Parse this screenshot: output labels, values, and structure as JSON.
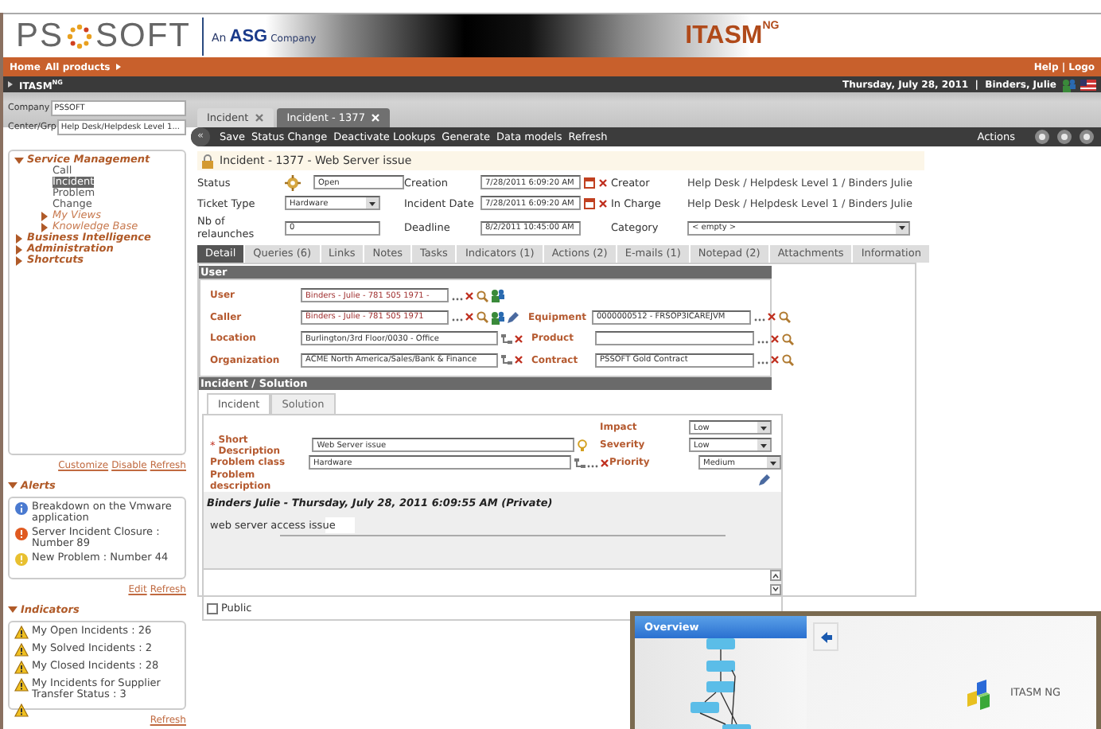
{
  "header": {
    "logo_left": "PS",
    "logo_right": "SOFT",
    "tagline_prefix": "An",
    "tagline_brand": "ASG",
    "tagline_suffix": "Company",
    "app_title": "ITASM",
    "app_title_sup": "NG"
  },
  "nav_bar": {
    "links": [
      "Home",
      "All products"
    ],
    "right_text": "Help | Logo"
  },
  "sub_bar": {
    "crumb": "ITASM$^{NG}$",
    "date_user": "Thursday, July 28, 2011  |  Binders, Julie"
  },
  "sidebar": {
    "company_label": "Company",
    "company_value": "PSSOFT",
    "center_label": "Center/Grp",
    "center_value": "Help Desk/Helpdesk Level 1...",
    "tree": [
      {
        "label": "Service Management",
        "expanded": true,
        "children": [
          {
            "label": "Call",
            "selected": false
          },
          {
            "label": "Incident",
            "selected": true
          },
          {
            "label": "Problem",
            "selected": false
          },
          {
            "label": "Change",
            "selected": false
          },
          {
            "label": "My Views",
            "expanded": false
          },
          {
            "label": "Knowledge Base",
            "expanded": false
          }
        ]
      },
      {
        "label": "Business Intelligence",
        "expanded": false
      },
      {
        "label": "Administration",
        "expanded": false
      },
      {
        "label": "Shortcuts",
        "expanded": false
      }
    ],
    "tree_links": [
      "Customize",
      "Disable",
      "Refresh"
    ],
    "alerts": {
      "title": "Alerts",
      "items": [
        {
          "kind": "info",
          "text": "Breakdown on the Vmware application"
        },
        {
          "kind": "error",
          "text": "Server Incident Closure : Number 89"
        },
        {
          "kind": "notice",
          "text": "New Problem : Number 44"
        }
      ],
      "links": [
        "Edit",
        "Refresh"
      ]
    },
    "indicators": {
      "title": "Indicators",
      "items": [
        {
          "kind": "warning",
          "text": "My Open Incidents : 26"
        },
        {
          "kind": "warning",
          "text": "My Solved Incidents : 2"
        },
        {
          "kind": "warning",
          "text": "My Closed Incidents : 28"
        },
        {
          "kind": "warning",
          "text": "My Incidents for Supplier Transfer Status : 3"
        },
        {
          "kind": "warning"
        }
      ],
      "links": [
        "Refresh"
      ]
    }
  },
  "tabs": [
    {
      "label": "Incident",
      "selected": false
    },
    {
      "label": "Incident - 1377",
      "selected": true
    }
  ],
  "toolbar": {
    "collapse": "«",
    "actions": [
      "Save",
      "Status Change",
      "Deactivate Lookups",
      "Generate",
      "Data models",
      "Refresh"
    ],
    "right_label": "Actions"
  },
  "incident": {
    "title": "Incident - 1377 - Web Server issue",
    "rows": [
      [
        {
          "label": "Status",
          "value": "Open",
          "kind": "status"
        },
        {
          "label": "Creation",
          "value": "7/28/2011 6:09:20 AM",
          "kind": "date"
        },
        {
          "label": "Creator",
          "value": "Help Desk / Helpdesk Level 1 / Binders Julie",
          "kind": "text"
        }
      ],
      [
        {
          "label": "Ticket Type",
          "value": "Hardware",
          "kind": "select"
        },
        {
          "label": "Incident Date",
          "value": "7/28/2011 6:09:20 AM",
          "kind": "date"
        },
        {
          "label": "In Charge",
          "value": "Help Desk / Helpdesk Level 1 / Binders Julie",
          "kind": "text"
        }
      ],
      [
        {
          "label": "Nb of relaunches",
          "value": "0",
          "kind": "input"
        },
        {
          "label": "Deadline",
          "value": "8/2/2011 10:45:00 AM",
          "kind": "input"
        },
        {
          "label": "Category",
          "value": "< empty >",
          "kind": "wideselect"
        }
      ]
    ]
  },
  "detail_tabs": [
    {
      "label": "Detail",
      "selected": true
    },
    {
      "label": "Queries (6)",
      "selected": false
    },
    {
      "label": "Links",
      "selected": false
    },
    {
      "label": "Notes",
      "selected": false
    },
    {
      "label": "Tasks",
      "selected": false
    },
    {
      "label": "Indicators (1)",
      "selected": false
    },
    {
      "label": "Actions (2)",
      "selected": false
    },
    {
      "label": "E-mails (1)",
      "selected": false
    },
    {
      "label": "Notepad (2)",
      "selected": false
    },
    {
      "label": "Attachments",
      "selected": false
    },
    {
      "label": "Information",
      "selected": false
    }
  ],
  "user_section": {
    "title": "User",
    "rows": [
      {
        "left": {
          "label": "User",
          "value": "Binders - Julie - 781 505 1971 -",
          "kind": "person"
        }
      },
      {
        "left": {
          "label": "Caller",
          "value": "Binders - Julie - 781 505 1971",
          "kind": "caller"
        },
        "right": {
          "label": "Equipment",
          "value": "0000000512 - FRSOP3ICAREJVM"
        }
      },
      {
        "left": {
          "label": "Location",
          "value": "Burlington/3rd Floor/0030 - Office",
          "kind": "tree"
        },
        "right": {
          "label": "Product"
        }
      },
      {
        "left": {
          "label": "Organization",
          "value": "ACME North America/Sales/Bank & Finance",
          "kind": "tree"
        },
        "right": {
          "label": "Contract",
          "value": "PSSOFT Gold Contract"
        }
      }
    ]
  },
  "incident_section": {
    "title": "Incident / Solution",
    "tabs": [
      {
        "label": "Incident",
        "selected": true
      },
      {
        "label": "Solution",
        "selected": false
      }
    ],
    "impact": {
      "label": "Impact",
      "value": "Low"
    },
    "short_description": {
      "required_mark": "*",
      "label": "Short Description",
      "value": "Web Server issue"
    },
    "severity": {
      "label": "Severity",
      "value": "Low"
    },
    "problem_class": {
      "label": "Problem class",
      "value": "Hardware"
    },
    "priority": {
      "label": "Priority",
      "value": "Medium"
    },
    "problem_description": {
      "label": "Problem description"
    },
    "note": {
      "author_line": "Binders Julie - Thursday, July 28, 2011 6:09:55 AM (Private)",
      "body": "web server access issue"
    },
    "public": {
      "label": "Public",
      "checked": false
    }
  },
  "overview": {
    "title": "Overview",
    "app_label": "ITASM NG"
  }
}
